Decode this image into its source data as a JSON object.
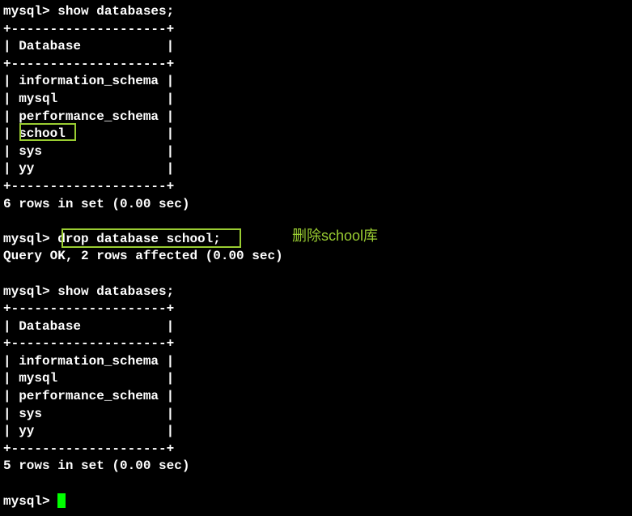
{
  "block1": {
    "cmd_line": "mysql> show databases;",
    "border_top": "+--------------------+",
    "header": "| Database           |",
    "border_mid": "+--------------------+",
    "rows": [
      "| information_schema |",
      "| mysql              |",
      "| performance_schema |",
      "| school             |",
      "| sys                |",
      "| yy                 |"
    ],
    "border_bot": "+--------------------+",
    "summary": "6 rows in set (0.00 sec)"
  },
  "drop": {
    "cmd_line": "mysql> drop database school;",
    "result": "Query OK, 2 rows affected (0.00 sec)"
  },
  "block2": {
    "cmd_line": "mysql> show databases;",
    "border_top": "+--------------------+",
    "header": "| Database           |",
    "border_mid": "+--------------------+",
    "rows": [
      "| information_schema |",
      "| mysql              |",
      "| performance_schema |",
      "| sys                |",
      "| yy                 |"
    ],
    "border_bot": "+--------------------+",
    "summary": "5 rows in set (0.00 sec)"
  },
  "final_prompt": "mysql> ",
  "annotation": "删除school库"
}
